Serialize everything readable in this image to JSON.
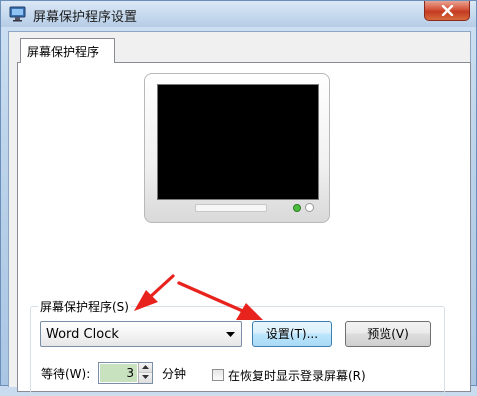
{
  "window": {
    "title": "屏幕保护程序设置",
    "icons": {
      "app": "display-settings-icon",
      "close": "close-icon"
    }
  },
  "tabs": [
    {
      "label": "屏幕保护程序",
      "selected": true
    }
  ],
  "preview": {
    "icon": "monitor-preview-icon"
  },
  "screensaver": {
    "group_label": "屏幕保护程序(S)",
    "selected_value": "Word Clock",
    "settings_button": "设置(T)...",
    "preview_button": "预览(V)"
  },
  "wait": {
    "label": "等待(W):",
    "value": "3",
    "unit": "分钟"
  },
  "resume": {
    "label": "在恢复时显示登录屏幕(R)",
    "checked": false
  },
  "annotations": {
    "arrow_color": "#e8231e",
    "arrow_count": 2
  }
}
